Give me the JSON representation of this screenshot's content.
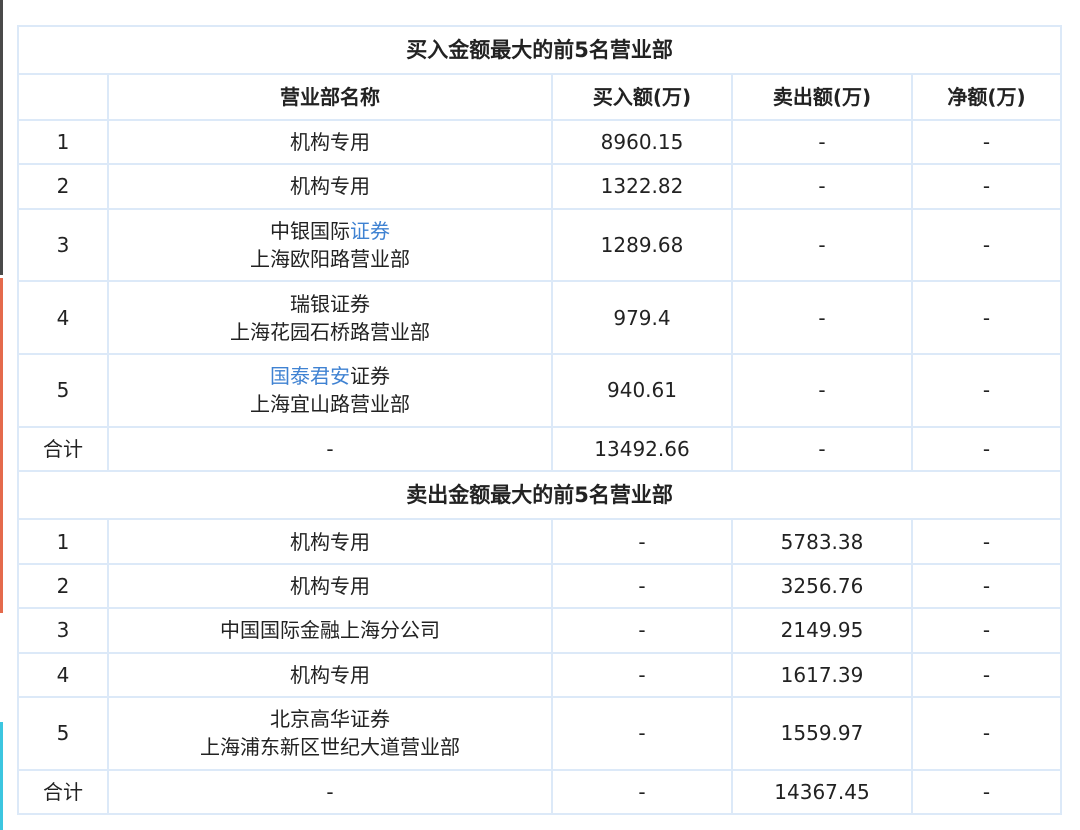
{
  "buy_section": {
    "title": "买入金额最大的前5名营业部",
    "headers": {
      "rank": "",
      "name": "营业部名称",
      "buy": "买入额(万)",
      "sell": "卖出额(万)",
      "net": "净额(万)"
    },
    "rows": [
      {
        "rank": "1",
        "name_line1": "机构专用",
        "buy": "8960.15",
        "sell": "-",
        "net": "-"
      },
      {
        "rank": "2",
        "name_line1": "机构专用",
        "buy": "1322.82",
        "sell": "-",
        "net": "-"
      },
      {
        "rank": "3",
        "name_line1_plain": "中银国际",
        "name_line1_link": "证券",
        "name_line2": "上海欧阳路营业部",
        "buy": "1289.68",
        "sell": "-",
        "net": "-"
      },
      {
        "rank": "4",
        "name_line1": "瑞银证券",
        "name_line2": "上海花园石桥路营业部",
        "buy": "979.4",
        "sell": "-",
        "net": "-"
      },
      {
        "rank": "5",
        "name_line1_link": "国泰君安",
        "name_line1_plain": "证券",
        "name_line2": "上海宜山路营业部",
        "buy": "940.61",
        "sell": "-",
        "net": "-"
      }
    ],
    "total": {
      "label": "合计",
      "name": "-",
      "buy": "13492.66",
      "sell": "-",
      "net": "-"
    }
  },
  "sell_section": {
    "title": "卖出金额最大的前5名营业部",
    "rows": [
      {
        "rank": "1",
        "name_line1": "机构专用",
        "buy": "-",
        "sell": "5783.38",
        "net": "-"
      },
      {
        "rank": "2",
        "name_line1": "机构专用",
        "buy": "-",
        "sell": "3256.76",
        "net": "-"
      },
      {
        "rank": "3",
        "name_line1": "中国国际金融上海分公司",
        "buy": "-",
        "sell": "2149.95",
        "net": "-"
      },
      {
        "rank": "4",
        "name_line1": "机构专用",
        "buy": "-",
        "sell": "1617.39",
        "net": "-"
      },
      {
        "rank": "5",
        "name_line1": "北京高华证券",
        "name_line2": "上海浦东新区世纪大道营业部",
        "buy": "-",
        "sell": "1559.97",
        "net": "-"
      }
    ],
    "total": {
      "label": "合计",
      "name": "-",
      "buy": "-",
      "sell": "14367.45",
      "net": "-"
    }
  },
  "colors": {
    "border": "#dce9f8",
    "link": "#3f82d2"
  }
}
